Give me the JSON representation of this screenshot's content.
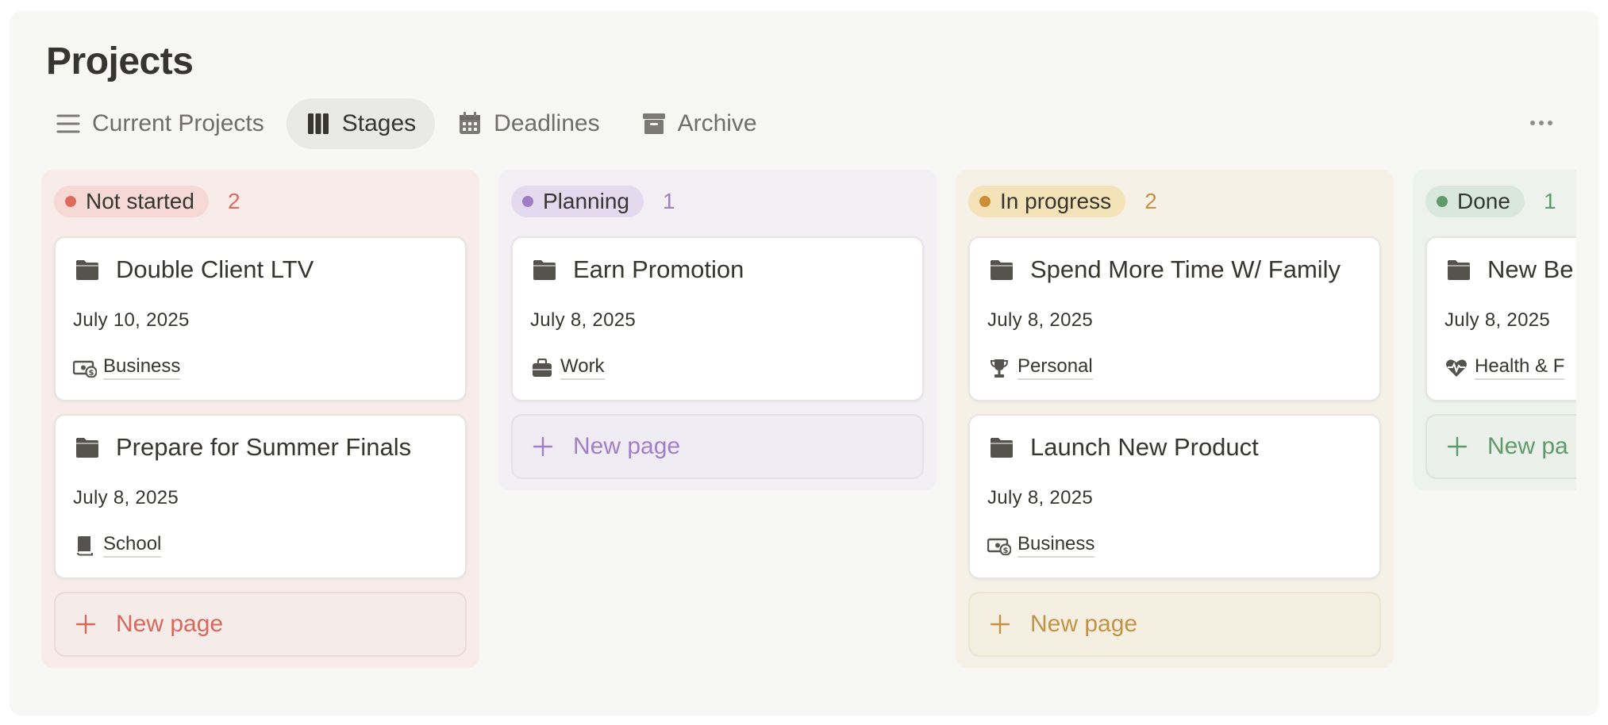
{
  "page": {
    "title": "Projects"
  },
  "tabs": [
    {
      "label": "Current Projects",
      "icon": "list-icon",
      "active": false
    },
    {
      "label": "Stages",
      "icon": "board-icon",
      "active": true
    },
    {
      "label": "Deadlines",
      "icon": "calendar-icon",
      "active": false
    },
    {
      "label": "Archive",
      "icon": "archive-icon",
      "active": false
    }
  ],
  "more_icon": "more-horizontal-icon",
  "columns": [
    {
      "status": "Not started",
      "count": "2",
      "colors": {
        "column_bg": "#f7ecea",
        "pill_bg": "#f6d9d5",
        "dot": "#de6a5c",
        "count": "#dc6b5c",
        "new_page_text": "#d6685c",
        "new_page_bg": "#f5ebe8",
        "new_page_border": "#eed8d3"
      },
      "cards": [
        {
          "title": "Double Client LTV",
          "date": "July 10, 2025",
          "tag": "Business",
          "tag_icon": "money-icon"
        },
        {
          "title": "Prepare for Summer Finals",
          "date": "July 8, 2025",
          "tag": "School",
          "tag_icon": "book-icon"
        }
      ],
      "new_page_label": "New page"
    },
    {
      "status": "Planning",
      "count": "1",
      "colors": {
        "column_bg": "#f2eff5",
        "pill_bg": "#e4d9ee",
        "dot": "#a07cc3",
        "count": "#9f7ec2",
        "new_page_text": "#a17fc5",
        "new_page_bg": "#f0ecf4",
        "new_page_border": "#e5dfec"
      },
      "cards": [
        {
          "title": "Earn Promotion",
          "date": "July 8, 2025",
          "tag": "Work",
          "tag_icon": "briefcase-icon"
        }
      ],
      "new_page_label": "New page"
    },
    {
      "status": "In progress",
      "count": "2",
      "colors": {
        "column_bg": "#f6f1e7",
        "pill_bg": "#f4e2b8",
        "dot": "#cc8f36",
        "count": "#c6923f",
        "new_page_text": "#c09346",
        "new_page_bg": "#f5efe2",
        "new_page_border": "#ece4d1"
      },
      "cards": [
        {
          "title": "Spend More Time W/ Family",
          "date": "July 8, 2025",
          "tag": "Personal",
          "tag_icon": "trophy-icon"
        },
        {
          "title": "Launch New Product",
          "date": "July 8, 2025",
          "tag": "Business",
          "tag_icon": "money-icon"
        }
      ],
      "new_page_label": "New page"
    },
    {
      "status": "Done",
      "count": "1",
      "colors": {
        "column_bg": "#eef2ee",
        "pill_bg": "#d9e8dc",
        "dot": "#5e9b6a",
        "count": "#5f9a6b",
        "new_page_text": "#5f9a6b",
        "new_page_bg": "#ebf0eb",
        "new_page_border": "#dbe5dc"
      },
      "cards": [
        {
          "title": "New Be",
          "date": "July 8, 2025",
          "tag": "Health & F",
          "tag_icon": "heart-pulse-icon"
        }
      ],
      "new_page_label": "New pa"
    }
  ]
}
